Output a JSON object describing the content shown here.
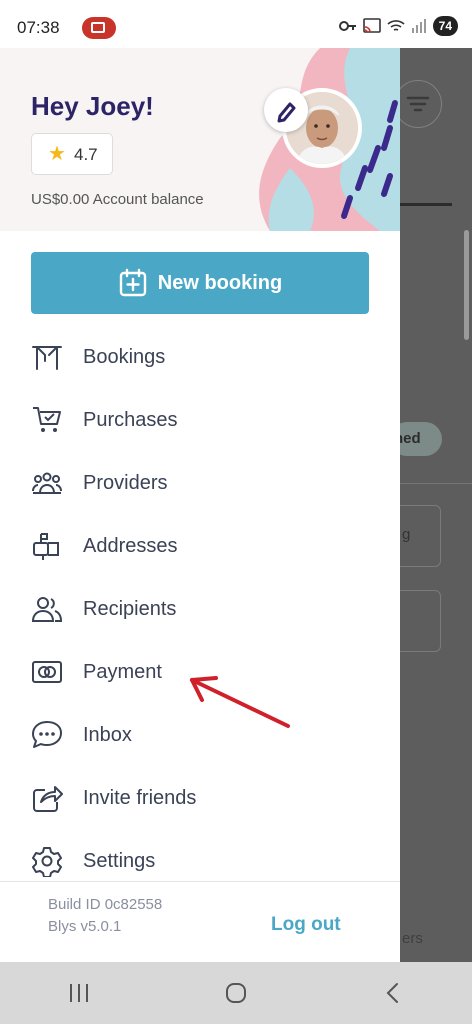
{
  "status_bar": {
    "time": "07:38",
    "battery": "74"
  },
  "header": {
    "greeting": "Hey Joey!",
    "rating": "4.7",
    "balance": "US$0.00 Account balance"
  },
  "new_booking_label": "New booking",
  "menu": [
    {
      "label": "Bookings",
      "icon": "bookings-icon"
    },
    {
      "label": "Purchases",
      "icon": "cart-icon"
    },
    {
      "label": "Providers",
      "icon": "providers-icon"
    },
    {
      "label": "Addresses",
      "icon": "mailbox-icon"
    },
    {
      "label": "Recipients",
      "icon": "recipients-icon"
    },
    {
      "label": "Payment",
      "icon": "payment-icon"
    },
    {
      "label": "Inbox",
      "icon": "chat-icon"
    },
    {
      "label": "Invite friends",
      "icon": "share-icon"
    },
    {
      "label": "Settings",
      "icon": "gear-icon"
    }
  ],
  "footer": {
    "build_id": "Build ID 0c82558",
    "version": "Blys v5.0.1",
    "logout_label": "Log out"
  },
  "background_app": {
    "tag_fragment": "ned",
    "card_fragment": "g",
    "footer_fragment": "ers"
  },
  "colors": {
    "accent": "#4aa8c6",
    "heading": "#2c2466",
    "annotation_arrow": "#d0202a",
    "star": "#f4b819"
  }
}
